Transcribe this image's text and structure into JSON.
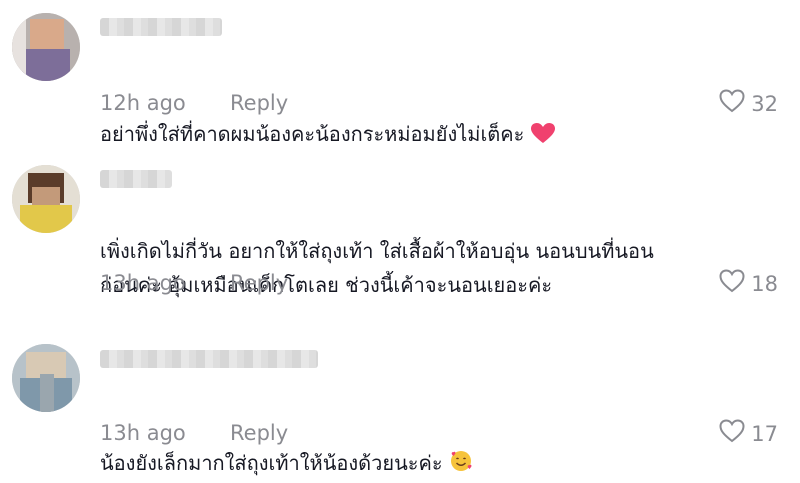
{
  "comments": [
    {
      "text": "อย่าพึ่งใส่ที่คาดผมน้องคะน้องกระหม่อมยังไม่เต็คะ",
      "emoji": "heart-emoji",
      "time": "12h ago",
      "reply": "Reply",
      "likes": "32"
    },
    {
      "text": "เพิ่งเกิดไม่กี่วัน อยากให้ใส่ถุงเท้า ใส่เสื้อผ้าให้อบอุ่น นอนบนที่นอน\nก่อนค่ะ อุ้มเหมือนเด็กโตเลย ช่วงนี้เค้าจะนอนเยอะค่ะ",
      "time": "13h ago",
      "reply": "Reply",
      "likes": "18"
    },
    {
      "text": "น้องยังเล็กมากใส่ถุงเท้าให้น้องด้วยนะค่ะ",
      "emoji": "smiling-face-with-hearts-emoji",
      "time": "13h ago",
      "reply": "Reply",
      "likes": "17"
    }
  ],
  "colors": {
    "text": "#161823",
    "meta": "#8a8b91",
    "heart": "#fe2c55"
  }
}
